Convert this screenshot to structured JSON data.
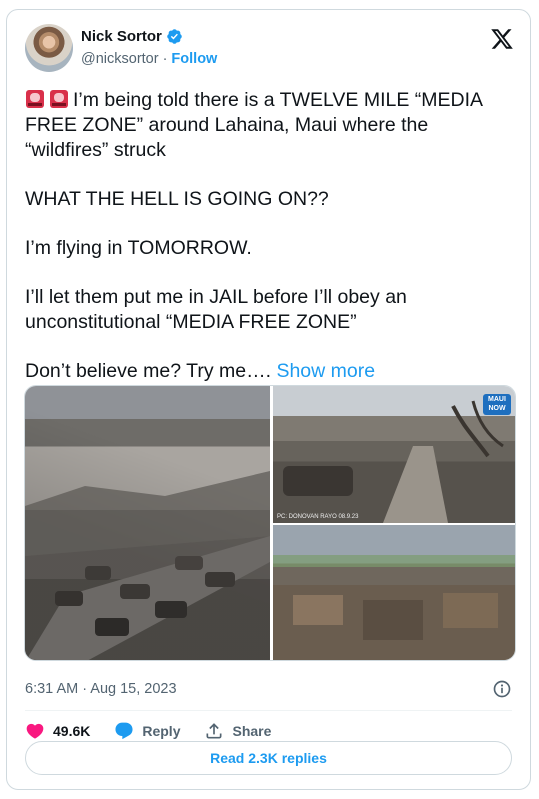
{
  "author": {
    "name": "Nick Sortor",
    "handle": "@nicksortor",
    "separator": "·",
    "follow_label": "Follow"
  },
  "tweet": {
    "paragraphs": [
      "I’m being told there is a TWELVE MILE “MEDIA FREE ZONE” around Lahaina, Maui where the “wildfires” struck",
      "WHAT THE HELL IS GOING ON??",
      "I’m flying in TOMORROW.",
      "I’ll let them put me in JAIL before I’ll obey an unconstitutional “MEDIA FREE ZONE”",
      "Don’t believe me? Try me…."
    ],
    "show_more_label": "Show more",
    "lead_icons": [
      "siren-emoji-icon",
      "siren-emoji-icon"
    ]
  },
  "media": {
    "badge_text": "MAUI NOW",
    "credit_text": "PC: DONOVAN RAYO 08.9.23"
  },
  "meta": {
    "timestamp": "6:31 AM · Aug 15, 2023"
  },
  "actions": {
    "likes": "49.6K",
    "reply_label": "Reply",
    "share_label": "Share"
  },
  "replies_button": "Read 2.3K replies",
  "colors": {
    "accent": "#1d9bf0",
    "like": "#f91880",
    "text": "#0f1419",
    "muted": "#536471"
  }
}
